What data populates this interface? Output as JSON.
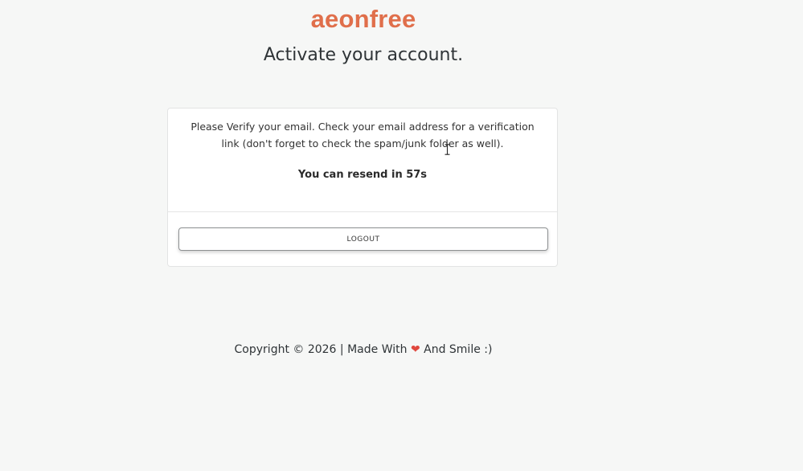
{
  "header": {
    "logo_text": "aeonfree",
    "page_title": "Activate your account."
  },
  "card": {
    "message_line1": "Please Verify your email. Check your email address for a verification",
    "message_line2": "link (don't forget to check the spam/junk folder as well).",
    "resend_text": "You can resend in 57s",
    "logout_label": "LOGOUT"
  },
  "footer": {
    "prefix": "Copyright © 2026 | Made With",
    "heart": "❤",
    "suffix": "And Smile :)"
  },
  "colors": {
    "brand": "#e06f4b",
    "heart": "#e0483e",
    "background": "#f6f7f6"
  },
  "icons": {
    "heart": "heart-icon",
    "cursor": "text-cursor-icon"
  }
}
